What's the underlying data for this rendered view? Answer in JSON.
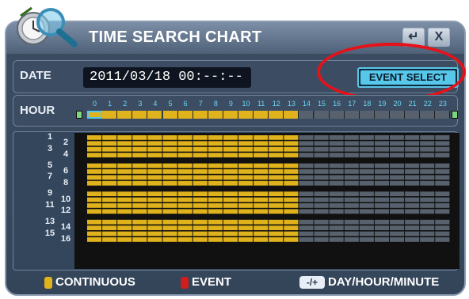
{
  "window": {
    "title": "TIME SEARCH CHART",
    "return_button": "↵",
    "close_button": "X"
  },
  "date": {
    "label": "DATE",
    "value": "2011/03/18 00:--:--"
  },
  "event_select": {
    "label": "EVENT SELECT"
  },
  "hour": {
    "label": "HOUR",
    "ticks": [
      "0",
      "1",
      "2",
      "3",
      "4",
      "5",
      "6",
      "7",
      "8",
      "9",
      "10",
      "11",
      "12",
      "13",
      "14",
      "15",
      "16",
      "17",
      "18",
      "19",
      "20",
      "21",
      "22",
      "23"
    ],
    "selected_hour": 0,
    "recorded_until_hour": 14
  },
  "channels": {
    "labels": [
      "1",
      "2",
      "3",
      "4",
      "5",
      "6",
      "7",
      "8",
      "9",
      "10",
      "11",
      "12",
      "13",
      "14",
      "15",
      "16"
    ],
    "recorded_until_hour": 14
  },
  "legend": {
    "continuous": "CONTINUOUS",
    "event": "EVENT",
    "zoom_button": "-/+",
    "zoom_label": "DAY/HOUR/MINUTE"
  },
  "colors": {
    "continuous": "#e0b21b",
    "event": "#d01e1e",
    "empty": "#58626e",
    "accent": "#58c8ea"
  }
}
